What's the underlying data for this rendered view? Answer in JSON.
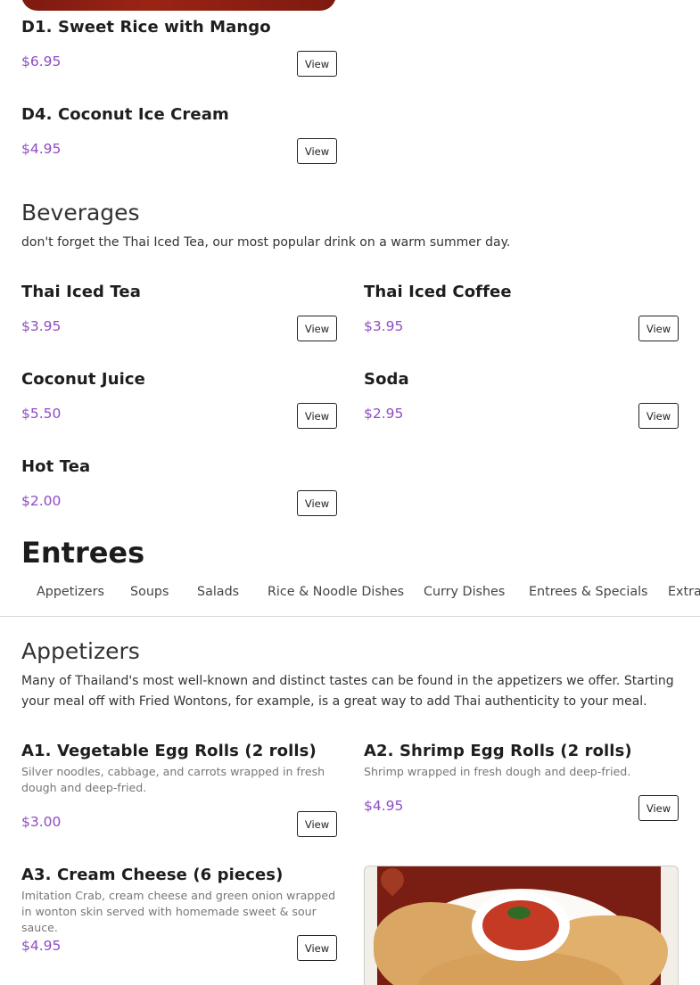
{
  "desserts": {
    "items": [
      {
        "title": "D1. Sweet Rice with Mango",
        "price": "$6.95",
        "view": "View"
      },
      {
        "title": "D4. Coconut Ice Cream",
        "price": "$4.95",
        "view": "View"
      }
    ]
  },
  "beverages": {
    "heading": "Beverages",
    "intro": "don't forget the Thai Iced Tea, our most popular drink on a warm summer day.",
    "items": [
      {
        "title": "Thai Iced Tea",
        "price": "$3.95",
        "view": "View"
      },
      {
        "title": "Thai Iced Coffee",
        "price": "$3.95",
        "view": "View"
      },
      {
        "title": "Coconut Juice",
        "price": "$5.50",
        "view": "View"
      },
      {
        "title": "Soda",
        "price": "$2.95",
        "view": "View"
      },
      {
        "title": "Hot Tea",
        "price": "$2.00",
        "view": "View"
      }
    ]
  },
  "entrees": {
    "heading": "Entrees",
    "tabs": [
      "Appetizers",
      "Soups",
      "Salads",
      "Rice & Noodle Dishes",
      "Curry Dishes",
      "Entrees & Specials",
      "Extra"
    ]
  },
  "appetizers": {
    "heading": "Appetizers",
    "intro": "Many of Thailand's most well-known and distinct tastes can be found in the appetizers we offer. Starting your meal off with Fried Wontons, for example, is a great way to add Thai authenticity to your meal.",
    "items": [
      {
        "title": "A1. Vegetable Egg Rolls (2 rolls)",
        "desc": "Silver noodles, cabbage, and carrots wrapped in fresh dough and deep-fried.",
        "price": "$3.00",
        "view": "View"
      },
      {
        "title": "A2. Shrimp Egg Rolls (2 rolls)",
        "desc": "Shrimp wrapped in fresh dough and deep-fried.",
        "price": "$4.95",
        "view": "View"
      },
      {
        "title": "A3. Cream Cheese (6 pieces)",
        "desc": "Imitation Crab, cream cheese and green onion wrapped in wonton skin served with homemade sweet & sour sauce.",
        "price": "$4.95",
        "view": "View"
      }
    ]
  },
  "colors": {
    "price": "#8f4cc4",
    "text": "#222222",
    "divider": "#d9d9d9"
  }
}
